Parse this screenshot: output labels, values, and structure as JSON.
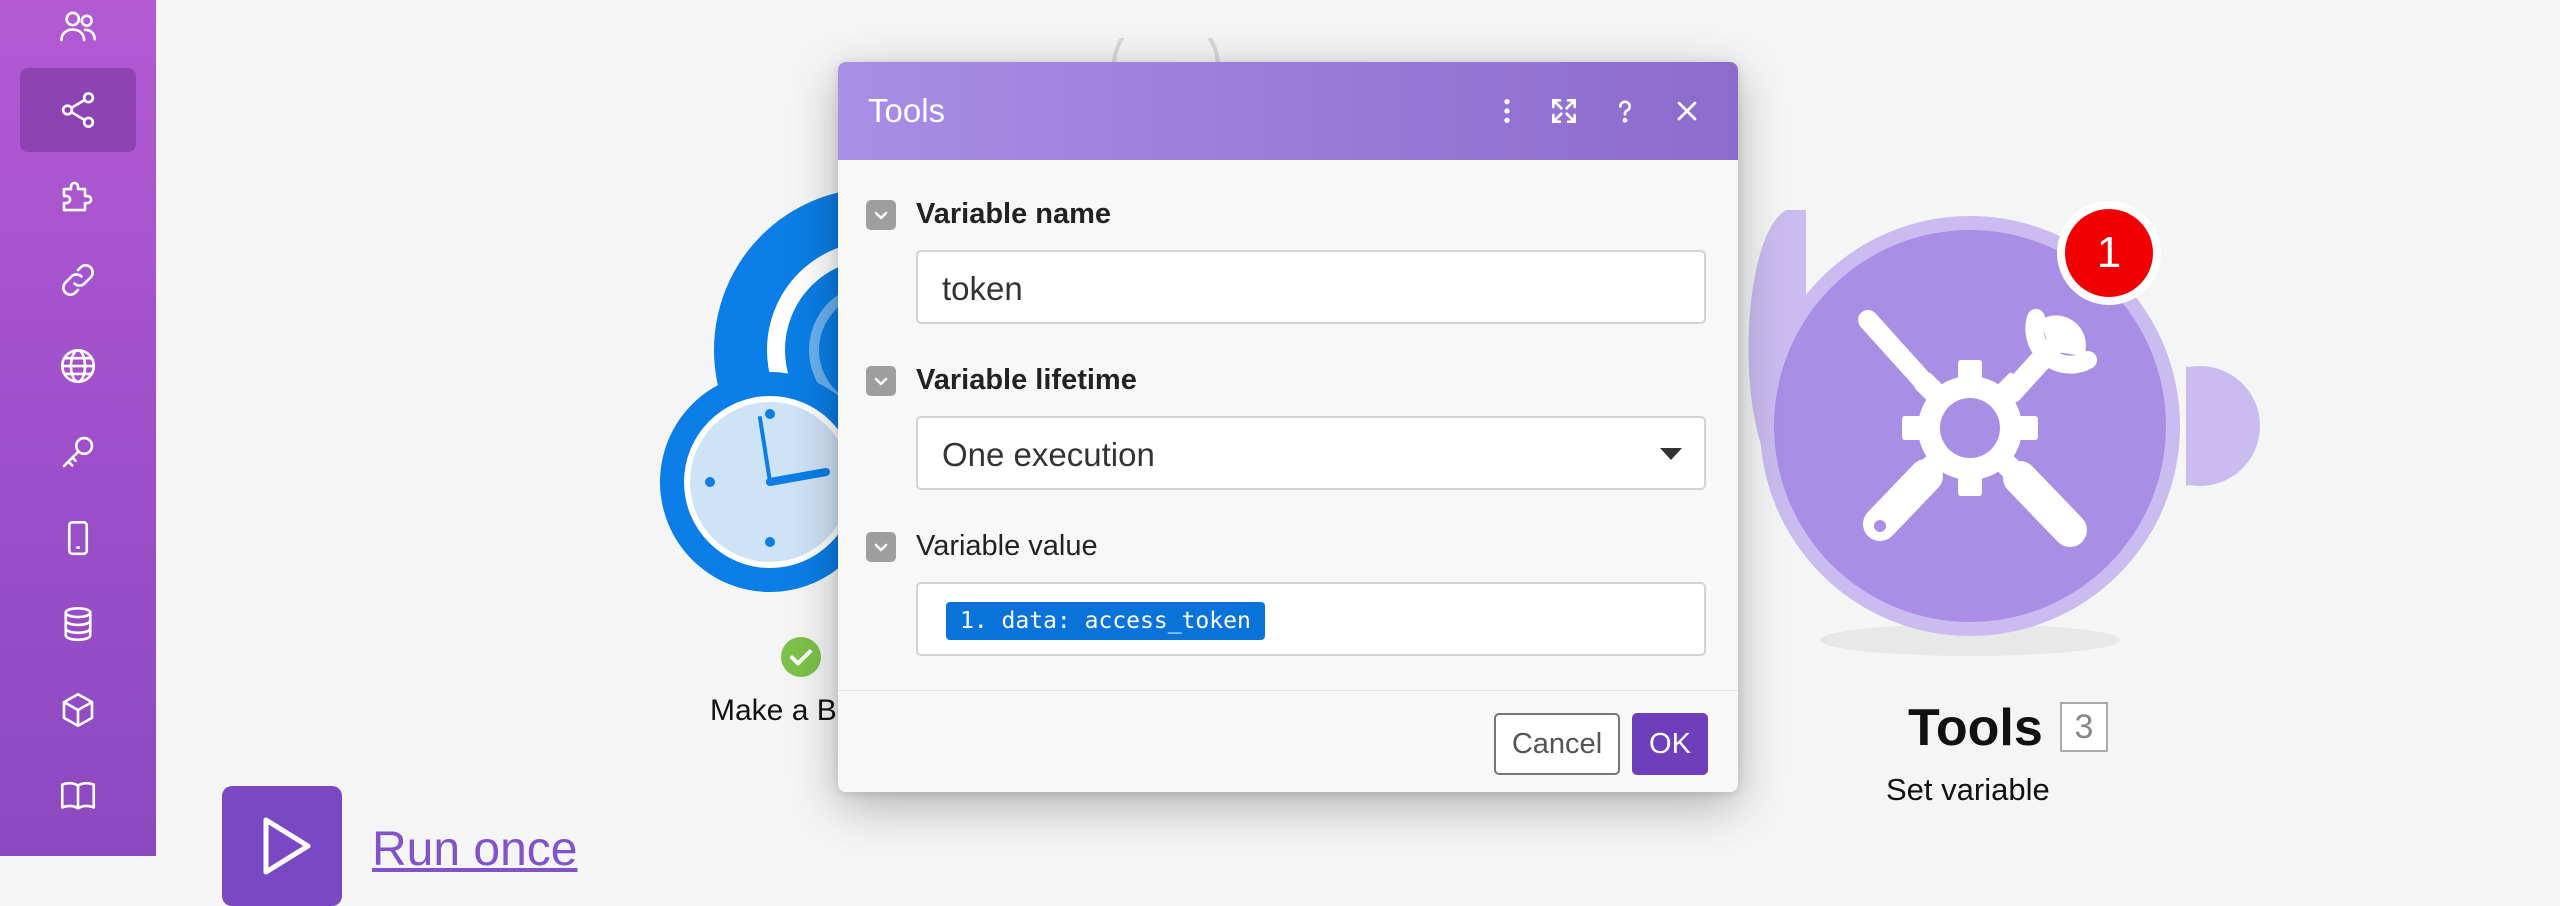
{
  "sidebar": {
    "items": [
      {
        "icon": "team-icon",
        "active": false
      },
      {
        "icon": "share-icon",
        "active": true
      },
      {
        "icon": "puzzle-icon",
        "active": false
      },
      {
        "icon": "link-icon",
        "active": false
      },
      {
        "icon": "globe-icon",
        "active": false
      },
      {
        "icon": "key-icon",
        "active": false
      },
      {
        "icon": "mobile-icon",
        "active": false
      },
      {
        "icon": "database-icon",
        "active": false
      },
      {
        "icon": "cube-icon",
        "active": false
      },
      {
        "icon": "book-icon",
        "active": false
      }
    ]
  },
  "canvas": {
    "http_module": {
      "label": "Make a B",
      "status": "success"
    },
    "tools_module": {
      "title": "Tools",
      "order": "3",
      "subtitle": "Set variable",
      "badge": "1"
    },
    "run_once": {
      "label": "Run once"
    }
  },
  "dialog": {
    "title": "Tools",
    "fields": [
      {
        "label": "Variable name",
        "value": "token"
      },
      {
        "label": "Variable lifetime",
        "value": "One execution"
      },
      {
        "label": "Variable value",
        "value": "1. data: access_token"
      }
    ],
    "cancel_label": "Cancel",
    "ok_label": "OK"
  },
  "colors": {
    "sidebar": "#a052cc",
    "dialog_header": "#9878d7",
    "tools_module": "#a98ee6",
    "http_module": "#0a7ee6",
    "badge": "#f00000",
    "ok_button": "#6f3fbb",
    "mapping_pill": "#0a73d9"
  }
}
